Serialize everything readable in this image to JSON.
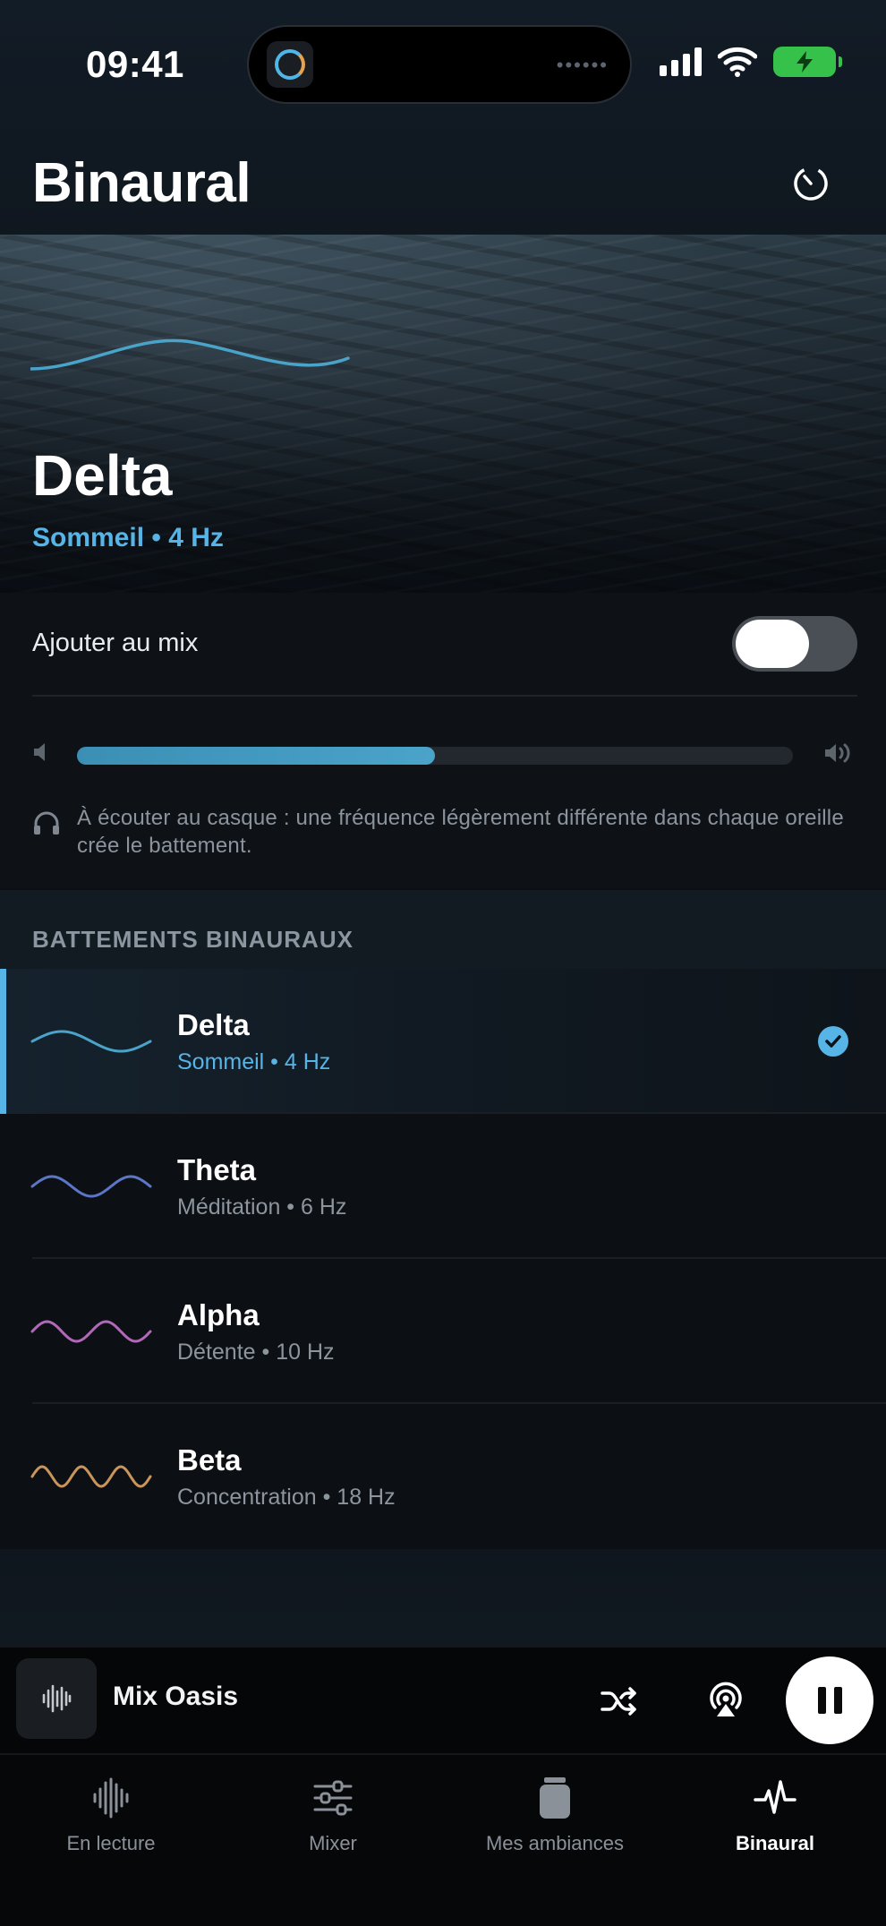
{
  "status_bar": {
    "time": "09:41",
    "island_app_icon": "mixer-ring-icon",
    "icons": [
      "cellular-signal-icon",
      "wifi-icon",
      "battery-charging-icon"
    ],
    "battery_color": "#36c24a"
  },
  "header": {
    "title": "Binaural",
    "timer_icon": "timer-icon"
  },
  "hero": {
    "title": "Delta",
    "subtitle": "Sommeil • 4 Hz",
    "wave_color": "#4aa3c9"
  },
  "controls": {
    "mix_label": "Ajouter au mix",
    "mix_toggle_on": false,
    "volume_fraction": 0.5,
    "hint": "À écouter au casque : une fréquence légèrement différente dans chaque oreille crée le battement."
  },
  "section": {
    "title": "BATTEMENTS BINAURAUX"
  },
  "beats": [
    {
      "name": "Delta",
      "subtitle": "Sommeil • 4 Hz",
      "color": "#4aa3c9",
      "selected": true,
      "cycles": 1
    },
    {
      "name": "Theta",
      "subtitle": "Méditation • 6 Hz",
      "color": "#5b76c6",
      "selected": false,
      "cycles": 1.5
    },
    {
      "name": "Alpha",
      "subtitle": "Détente • 10 Hz",
      "color": "#b069b8",
      "selected": false,
      "cycles": 2
    },
    {
      "name": "Beta",
      "subtitle": "Concentration • 18 Hz",
      "color": "#c9955a",
      "selected": false,
      "cycles": 3
    }
  ],
  "player": {
    "title": "Mix Oasis",
    "art_icon": "waveform-icon",
    "playing": true
  },
  "tabs": [
    {
      "label": "En lecture",
      "icon": "waveform-icon",
      "active": false
    },
    {
      "label": "Mixer",
      "icon": "sliders-icon",
      "active": false
    },
    {
      "label": "Mes ambiances",
      "icon": "jar-icon",
      "active": false
    },
    {
      "label": "Binaural",
      "icon": "pulse-icon",
      "active": true
    }
  ],
  "colors": {
    "accent": "#57b4e6",
    "background": "#0d1117"
  }
}
